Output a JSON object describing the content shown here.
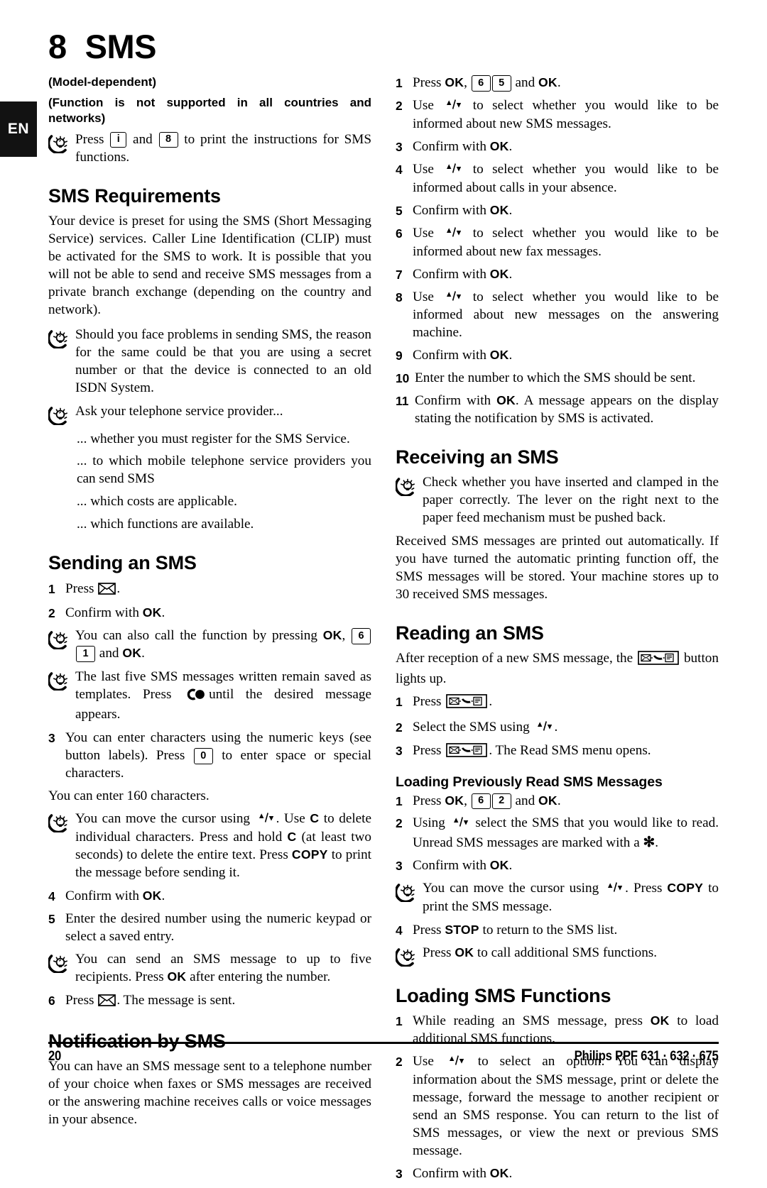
{
  "page": {
    "language_tab": "EN",
    "chapter_number": "8",
    "chapter_title": "SMS",
    "footer_page_number": "20",
    "footer_brand": "Philips PPF 631 · 632 · 675"
  },
  "left_column": {
    "intro_line_1": "(Model-dependent)",
    "intro_line_2": "(Function is not supported in all countries and networks)",
    "tip_print_instructions": {
      "pre": "Press",
      "key_1": "i",
      "mid": "and",
      "key_2": "8",
      "post": "to print the instructions for SMS functions."
    },
    "sms_requirements": {
      "heading": "SMS Requirements",
      "paragraph": "Your device is preset for using the SMS (Short Messaging Service) services. Caller Line Identification (CLIP) must be activated for the SMS to work. It is possible that you will not be able to send and receive SMS messages from a private branch exchange (depending on the country and network).",
      "tip_problems": "Should you face problems in sending SMS, the reason for the same could be that you are using a secret number or that the device is connected to an old ISDN System.",
      "tip_ask_provider": "Ask your telephone service provider...",
      "dots": [
        "... whether you must register for the SMS Service.",
        "... to which mobile telephone service providers you can send SMS",
        "... which costs are applicable.",
        "... which functions are available."
      ]
    },
    "sending_an_sms": {
      "heading": "Sending an SMS",
      "step_1_pre": "Press",
      "step_1_post": ".",
      "step_2_pre": "Confirm with",
      "step_2_key": "OK",
      "step_2_post": ".",
      "tip_call_function": {
        "pre": "You can also call the function by pressing",
        "key_ok": "OK",
        "comma": ",",
        "key_6": "6",
        "key_1": "1",
        "mid": "and",
        "key_ok_2": "OK",
        "post": "."
      },
      "tip_templates": {
        "pre": "The last five SMS messages written remain saved as templates. Press",
        "post": "until the desired message appears."
      },
      "step_3_pre": "You can enter characters using the numeric keys (see button labels). Press",
      "step_3_key": "0",
      "step_3_post": "to enter space or special characters.",
      "note_160": "You can enter 160 characters.",
      "tip_cursor": {
        "pre": "You can move the cursor using",
        "mid1": ". Use",
        "key_c1": "C",
        "mid2": "to delete individual characters. Press and hold",
        "key_c2": "C",
        "mid3": "(at least two seconds) to delete the entire text. Press",
        "key_copy": "COPY",
        "post": "to print the message before sending it."
      },
      "step_4_pre": "Confirm with",
      "step_4_key": "OK",
      "step_4_post": ".",
      "step_5": "Enter the desired number using the numeric keypad or select a saved entry.",
      "tip_five_recipients": {
        "pre": "You can send an SMS message to up to five recipients. Press",
        "key_ok": "OK",
        "post": "after entering the number."
      },
      "step_6_pre": "Press",
      "step_6_post": ". The message is sent."
    },
    "notification_by_sms": {
      "heading": "Notification by SMS",
      "paragraph": "You can have an SMS message sent to a telephone number of your choice when faxes or SMS messages are received or the answering machine receives calls or voice messages in your absence."
    }
  },
  "right_column": {
    "notification_steps": [
      {
        "n": "1",
        "pre": "Press",
        "key_ok": "OK",
        "comma": ",",
        "key_a": "6",
        "key_b": "5",
        "mid": "and",
        "key_ok_2": "OK",
        "post": "."
      },
      {
        "n": "2",
        "pre": "Use",
        "post": "to select whether you would like to be informed about new SMS messages."
      },
      {
        "n": "3",
        "pre": "Confirm with",
        "key_ok": "OK",
        "post": "."
      },
      {
        "n": "4",
        "pre": "Use",
        "post": "to select whether you would like to be informed about calls in your absence."
      },
      {
        "n": "5",
        "pre": "Confirm with",
        "key_ok": "OK",
        "post": "."
      },
      {
        "n": "6",
        "pre": "Use",
        "post": "to select whether you would like to be informed about new fax messages."
      },
      {
        "n": "7",
        "pre": "Confirm with",
        "key_ok": "OK",
        "post": "."
      },
      {
        "n": "8",
        "pre": "Use",
        "post": "to select whether you would like to be informed about new messages on the answering machine."
      },
      {
        "n": "9",
        "pre": "Confirm with",
        "key_ok": "OK",
        "post": "."
      },
      {
        "n": "10",
        "text": "Enter the number to which the SMS should be sent."
      },
      {
        "n": "11",
        "pre": "Confirm with",
        "key_ok": "OK",
        "post": ". A message appears on the display stating the notification by SMS is activated."
      }
    ],
    "receiving_an_sms": {
      "heading": "Receiving an SMS",
      "tip_paper": "Check whether you have inserted and clamped in the paper correctly. The lever on the right next to the paper feed mechanism must be pushed back.",
      "paragraph": "Received SMS messages are printed out automatically. If you have turned the automatic printing function off, the SMS messages will be stored. Your machine stores up to 30 received SMS messages."
    },
    "reading_an_sms": {
      "heading": "Reading an SMS",
      "intro_pre": "After reception of a new SMS message, the",
      "intro_post": "button lights up.",
      "step_1_pre": "Press",
      "step_1_post": ".",
      "step_2_pre": "Select the SMS using",
      "step_2_post": ".",
      "step_3_pre": "Press",
      "step_3_post": ". The Read SMS menu opens."
    },
    "loading_previously_read": {
      "heading": "Loading Previously Read SMS Messages",
      "step_1": {
        "pre": "Press",
        "key_ok": "OK",
        "comma": ",",
        "key_a": "6",
        "key_b": "2",
        "mid": "and",
        "key_ok_2": "OK",
        "post": "."
      },
      "step_2": {
        "pre": "Using",
        "mid": "select the SMS that you would like to read. Unread SMS messages are marked with a",
        "star": "✻",
        "post": "."
      },
      "step_3": {
        "pre": "Confirm with",
        "key_ok": "OK",
        "post": "."
      },
      "tip_cursor": {
        "pre": "You can move the cursor using",
        "mid": ". Press",
        "key_copy": "COPY",
        "post": "to print the SMS message."
      },
      "step_4": {
        "pre": "Press",
        "key_stop": "STOP",
        "post": "to return to the SMS list."
      },
      "tip_additional": {
        "pre": "Press",
        "key_ok": "OK",
        "post": "to call additional SMS functions."
      }
    },
    "loading_sms_functions": {
      "heading": "Loading SMS Functions",
      "step_1": {
        "pre": "While reading an SMS message, press",
        "key_ok": "OK",
        "post": "to load additional SMS functions."
      },
      "step_2": {
        "pre": "Use",
        "post": "to select an option: You can display information about the SMS message, print or delete the message, forward the message to another recipient or send an SMS response. You can return to the list of SMS messages, or view the next or previous SMS message."
      },
      "step_3": {
        "pre": "Confirm with",
        "key_ok": "OK",
        "post": "."
      }
    }
  },
  "icons": {
    "tip": "lightbulb-tip-icon",
    "envelope": "envelope-icon",
    "updown": "up-down-arrow-icon",
    "redial": "redial-icon",
    "sms_button": "sms-message-button-icon"
  }
}
